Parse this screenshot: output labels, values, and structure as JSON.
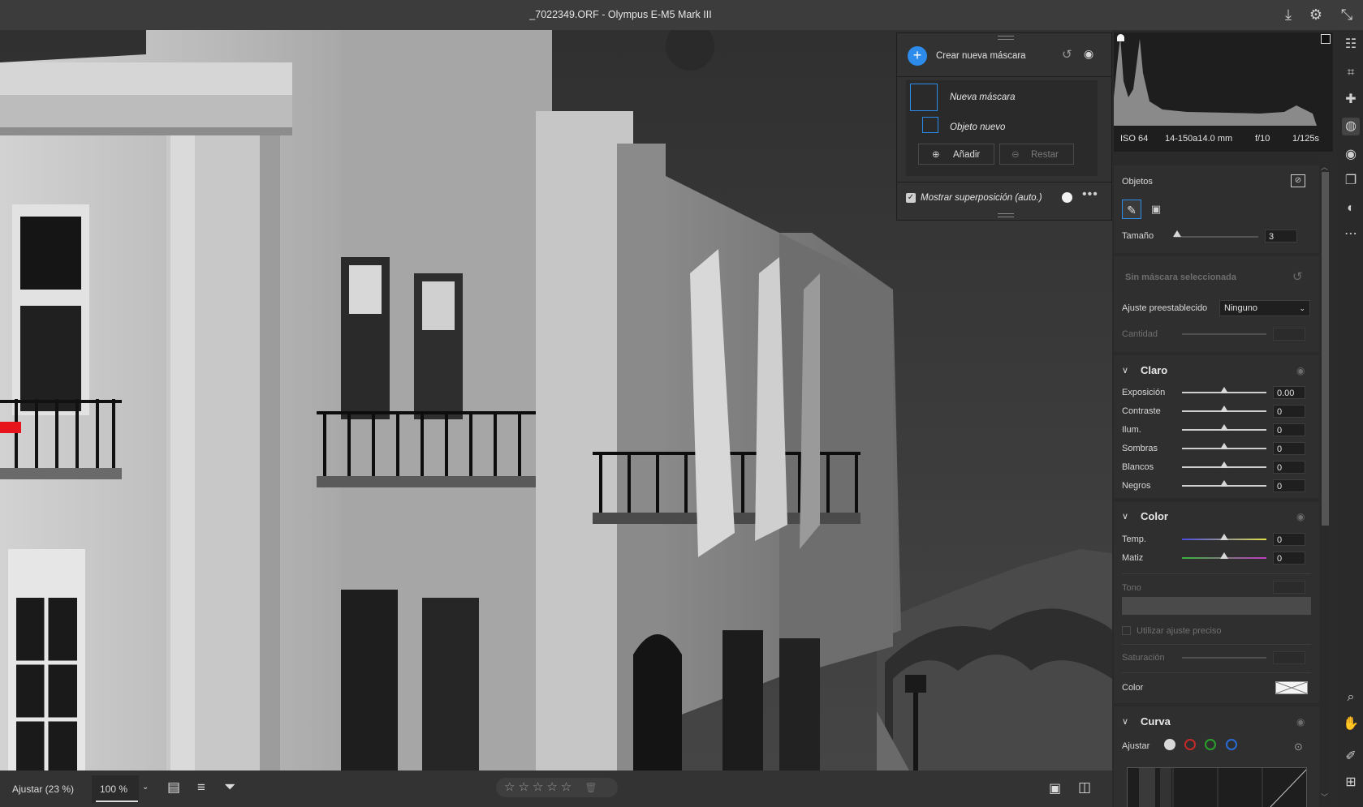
{
  "window": {
    "title": "_7022349.ORF  -  Olympus E-M5 Mark III"
  },
  "masks_panel": {
    "create_label": "Crear nueva máscara",
    "mask_name": "Nueva máscara",
    "object_name": "Objeto nuevo",
    "add_label": "Añadir",
    "subtract_label": "Restar",
    "overlay_label": "Mostrar superposición (auto.)",
    "overlay_checked": true
  },
  "exif": {
    "iso": "ISO 64",
    "lens": "14-150a14.0 mm",
    "aperture": "f/10",
    "shutter": "1/125s"
  },
  "objects_section": {
    "title": "Objetos",
    "size_label": "Tamaño",
    "size_value": "3"
  },
  "mask_settings": {
    "no_mask": "Sin máscara seleccionada",
    "preset_label": "Ajuste preestablecido",
    "preset_value": "Ninguno",
    "amount_label": "Cantidad"
  },
  "light_section": {
    "title": "Claro",
    "rows": [
      {
        "label": "Exposición",
        "value": "0.00"
      },
      {
        "label": "Contraste",
        "value": "0"
      },
      {
        "label": "Ilum.",
        "value": "0"
      },
      {
        "label": "Sombras",
        "value": "0"
      },
      {
        "label": "Blancos",
        "value": "0"
      },
      {
        "label": "Negros",
        "value": "0"
      }
    ]
  },
  "color_section": {
    "title": "Color",
    "temp_label": "Temp.",
    "temp_value": "0",
    "tint_label": "Matiz",
    "tint_value": "0",
    "hue_label": "Tono",
    "fine_label": "Utilizar ajuste preciso",
    "sat_label": "Saturación",
    "color_label": "Color"
  },
  "curve_section": {
    "title": "Curva",
    "adjust_label": "Ajustar"
  },
  "bottom_bar": {
    "fit_label": "Ajustar (23 %)",
    "zoom_value": "100 %",
    "stars": "☆☆☆☆☆",
    "trash": "🗑"
  },
  "colors": {
    "accent": "#2d8ceb",
    "panel": "#2f2f2f",
    "mask_red": "#e8141b"
  }
}
